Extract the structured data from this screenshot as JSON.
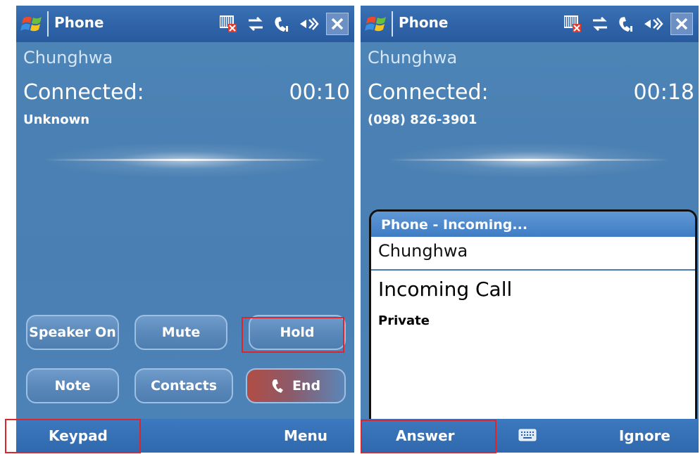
{
  "left_screen": {
    "titlebar": {
      "title": "Phone"
    },
    "carrier": "Chunghwa",
    "status": "Connected:",
    "timer": "00:10",
    "caller": "Unknown",
    "buttons": {
      "speaker": "Speaker On",
      "mute": "Mute",
      "hold": "Hold",
      "note": "Note",
      "contacts": "Contacts",
      "end": "End"
    },
    "softkeys": {
      "left": "Keypad",
      "right": "Menu"
    }
  },
  "right_screen": {
    "titlebar": {
      "title": "Phone"
    },
    "carrier": "Chunghwa",
    "status": "Connected:",
    "timer": "00:18",
    "caller": "(098) 826-3901",
    "dialog": {
      "title": "Phone - Incoming...",
      "carrier": "Chunghwa",
      "heading": "Incoming Call",
      "caller": "Private"
    },
    "softkeys": {
      "left": "Answer",
      "right": "Ignore"
    }
  },
  "colors": {
    "highlight": "#e0242a",
    "screen_bg": "#4a80b3",
    "titlebar": "#2f63a8"
  },
  "icons": [
    "windows-logo-icon",
    "sim-card-icon",
    "data-sync-icon",
    "phone-signal-icon",
    "speaker-icon",
    "close-icon",
    "phone-icon",
    "keyboard-icon"
  ]
}
